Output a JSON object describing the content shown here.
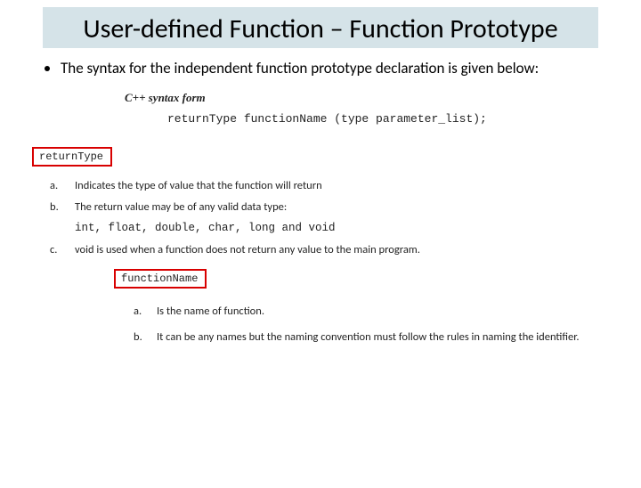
{
  "title": "User-defined Function – Function Prototype",
  "bullet": "The syntax for the independent function prototype declaration is given below:",
  "syntaxLabel": "C++ syntax form",
  "syntaxLine": "returnType functionName (type parameter_list);",
  "box1": "returnType",
  "list1": {
    "a": "Indicates the type of value that the function will return",
    "b": "The return value may be of any valid data type:",
    "types": "int, float, double, char, long and void",
    "c": "void is used when a function does not return any value to the main program."
  },
  "box2": "functionName",
  "list2": {
    "a": "Is the name of function.",
    "b": "It can be any names but the naming convention must follow the rules in naming the identifier."
  }
}
